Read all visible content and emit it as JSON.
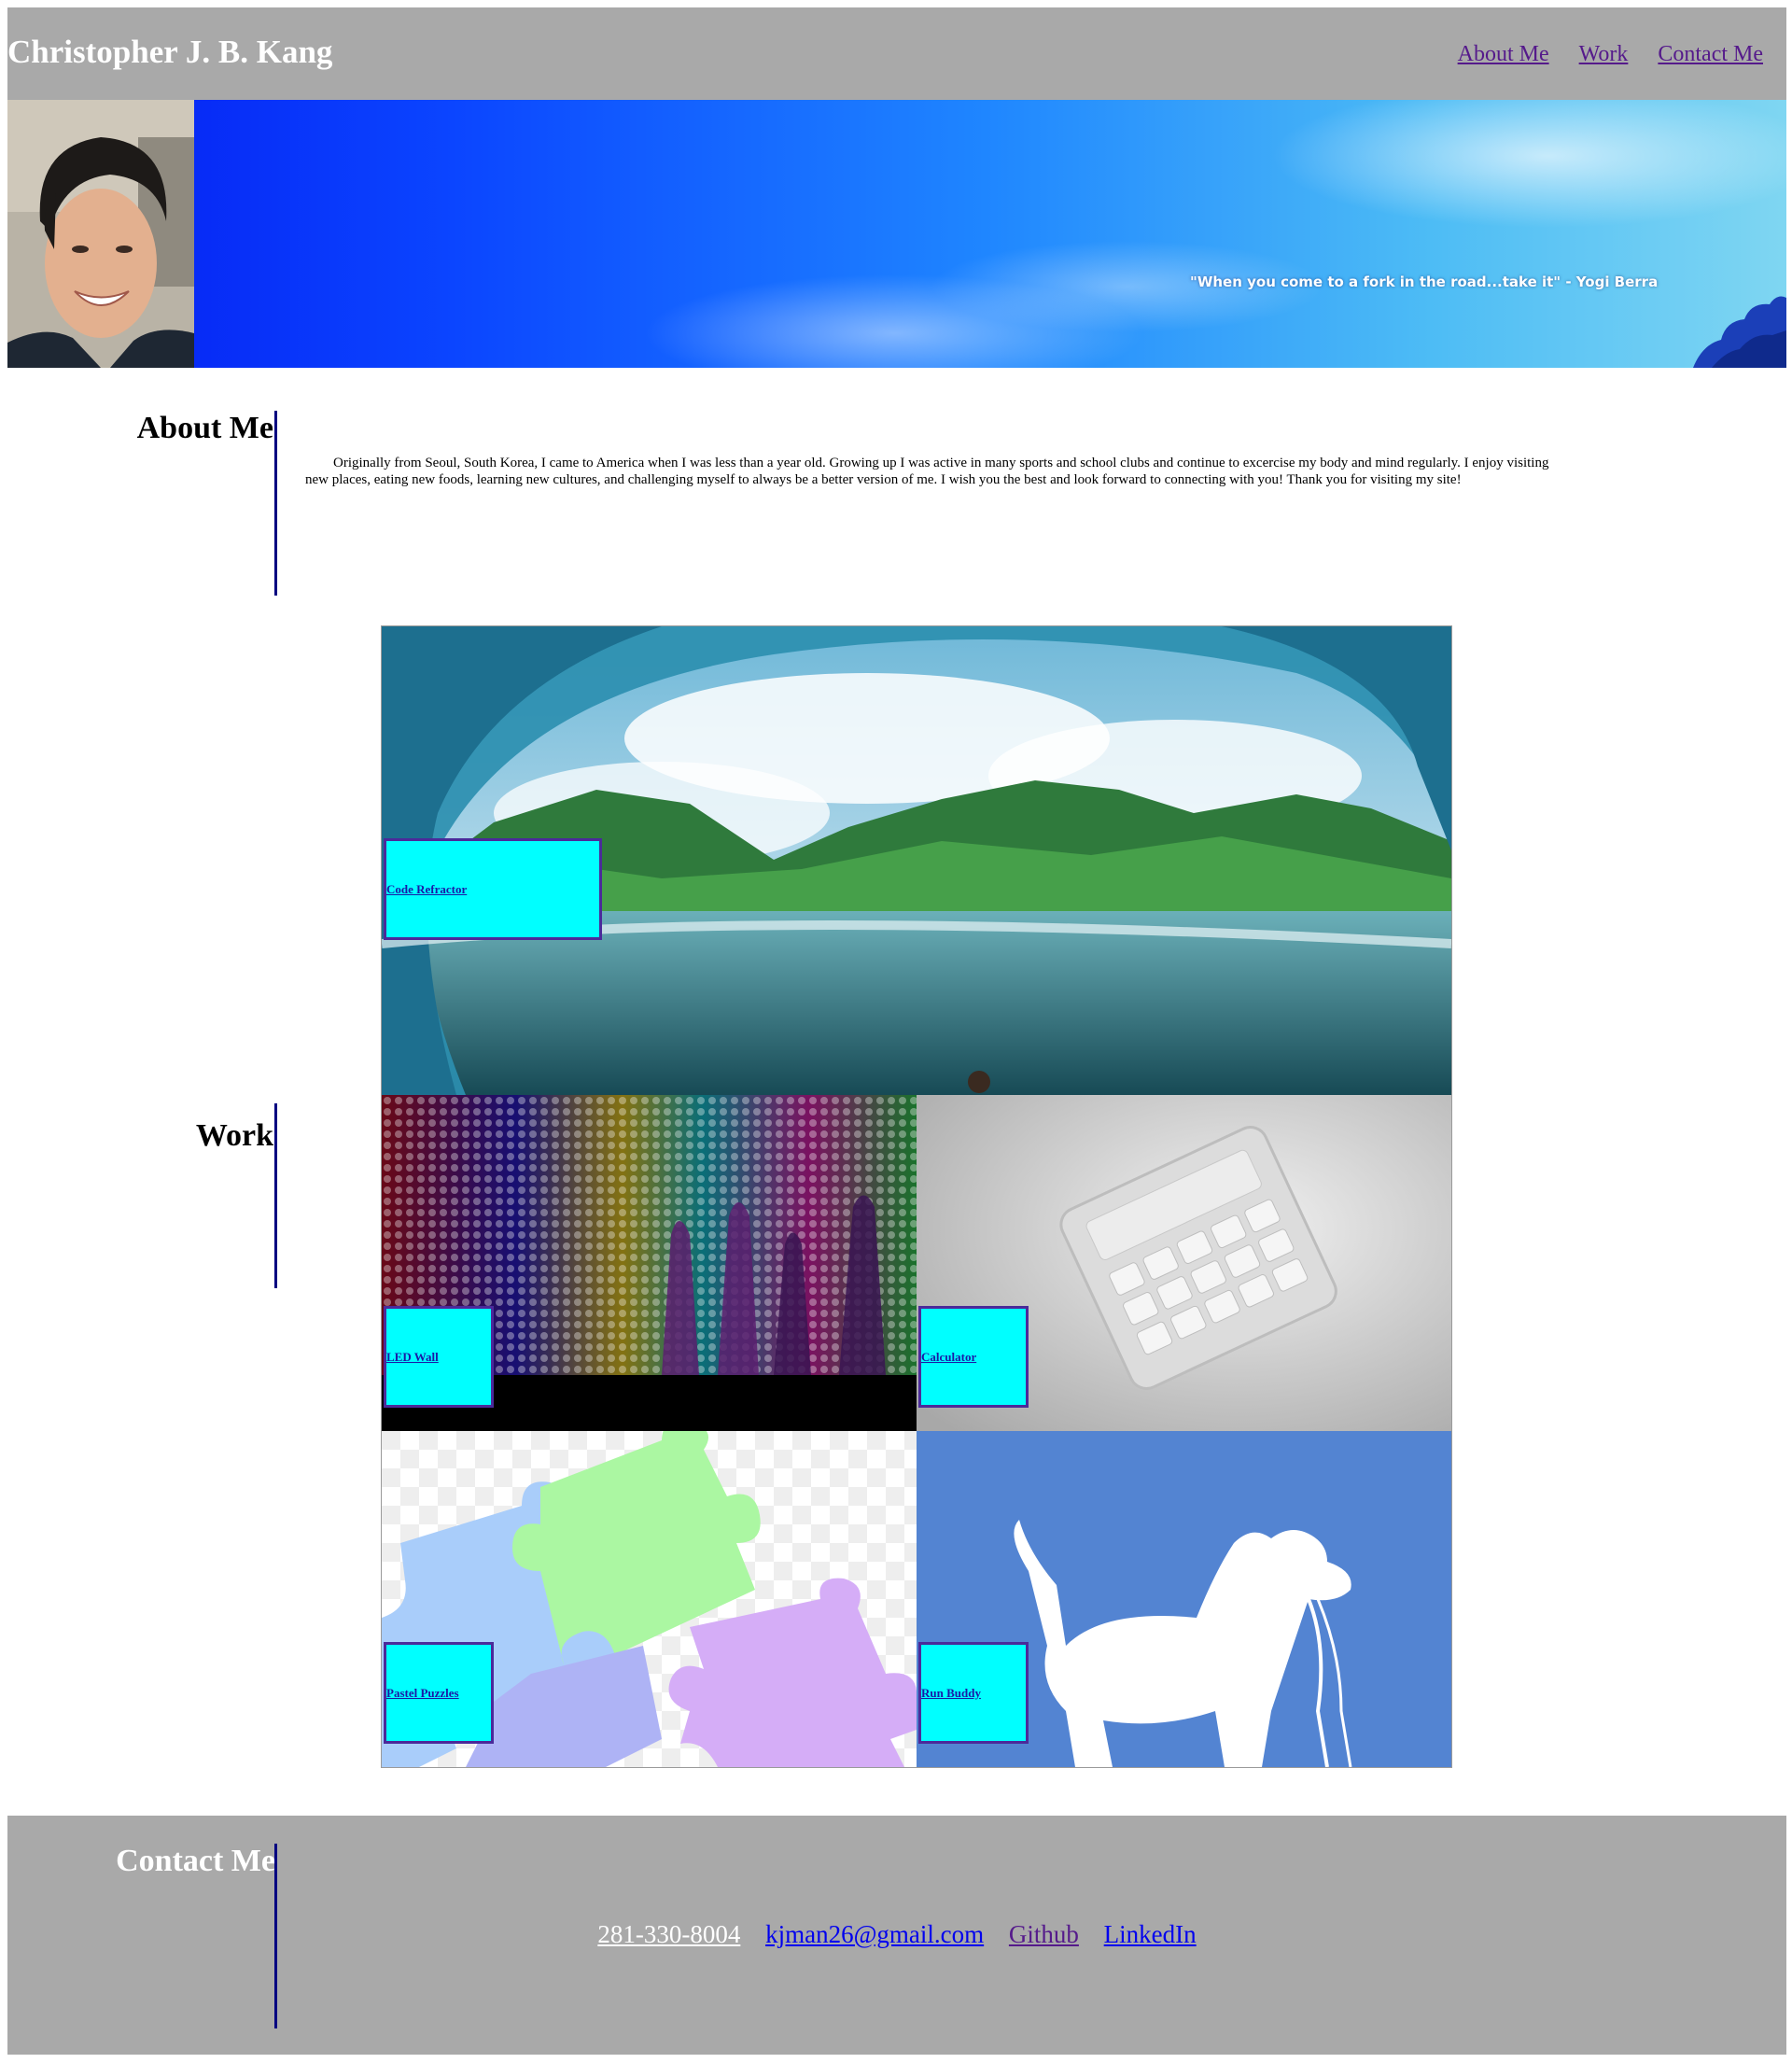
{
  "header": {
    "title": "Christopher J. B. Kang",
    "nav": [
      {
        "label": "About Me"
      },
      {
        "label": "Work"
      },
      {
        "label": "Contact Me"
      }
    ]
  },
  "hero": {
    "quote": "\"When you come to a fork in the road...take it\" - Yogi Berra"
  },
  "about": {
    "heading": "About Me",
    "text": "Originally from Seoul, South Korea, I came to America when I was less than a year old. Growing up I was active in many sports and school clubs and continue to excercise my body and mind regularly. I enjoy visiting new places, eating new foods, learning new cultures, and challenging myself to always be a better version of me. I wish you the best and look forward to connecting with you! Thank you for visiting my site!"
  },
  "work": {
    "heading": "Work",
    "projects": [
      {
        "label": "Code Refractor",
        "image": "ocean-wave-mountains"
      },
      {
        "label": "LED Wall",
        "image": "led-wall-dancers"
      },
      {
        "label": "Calculator",
        "image": "white-calculator"
      },
      {
        "label": "Pastel Puzzles",
        "image": "pastel-puzzle-pieces"
      },
      {
        "label": "Run Buddy",
        "image": "dog-with-leash"
      }
    ]
  },
  "contact": {
    "heading": "Contact Me",
    "links": [
      {
        "label": "281-330-8004",
        "color": "#ffffff"
      },
      {
        "label": "kjman26@gmail.com",
        "color": "#0000ee"
      },
      {
        "label": "Github",
        "color": "#551a8b"
      },
      {
        "label": "LinkedIn",
        "color": "#0000ee"
      }
    ]
  },
  "colors": {
    "header_bg": "#a9a9a9",
    "link_box": "#00ffff",
    "rule": "#000080"
  }
}
